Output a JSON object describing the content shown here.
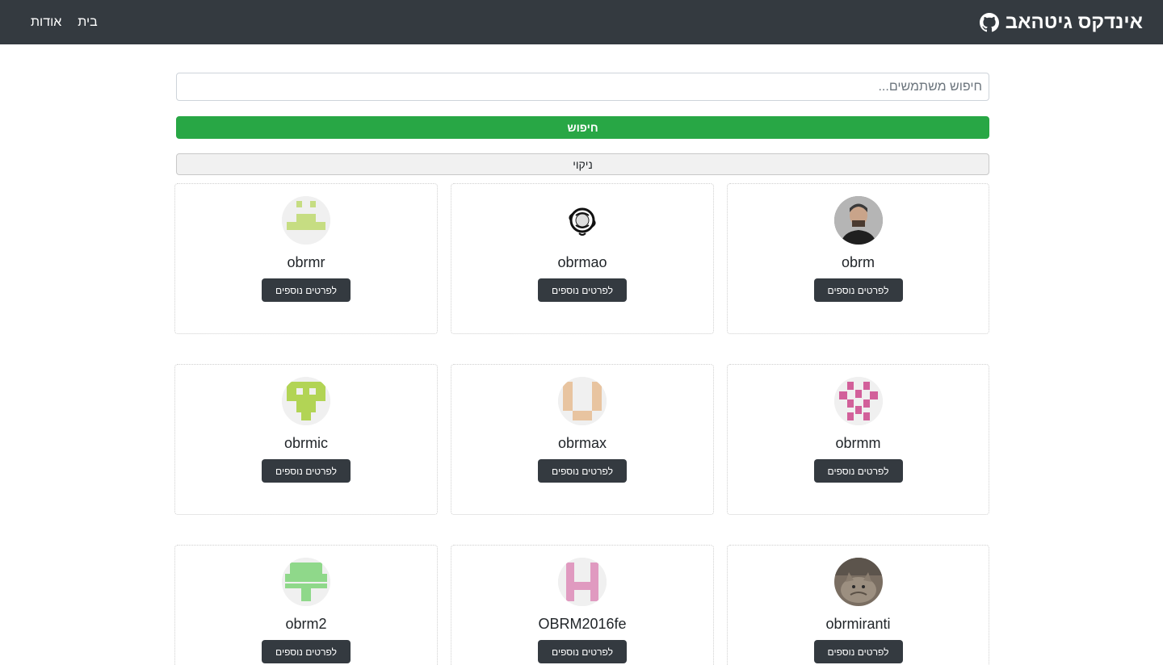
{
  "navbar": {
    "brand": "אינדקס גיטהאב",
    "brand_icon": "github-icon",
    "links": [
      "בית",
      "אודות"
    ]
  },
  "search": {
    "placeholder": "חיפוש משתמשים...",
    "value": "",
    "submit_label": "חיפוש",
    "clear_label": "ניקוי"
  },
  "colors": {
    "navbar": "#343a40",
    "search_button": "#28a745",
    "more_button": "#343a40"
  },
  "users": [
    {
      "login": "obrm",
      "avatar": "photo-portrait-icon",
      "button": "לפרטים נוספים"
    },
    {
      "login": "obrmao",
      "avatar": "ornament-icon",
      "button": "לפרטים נוספים"
    },
    {
      "login": "obrmr",
      "avatar": "identicon-green-icon",
      "button": "לפרטים נוספים"
    },
    {
      "login": "obrmm",
      "avatar": "identicon-pink-icon",
      "button": "לפרטים נוספים"
    },
    {
      "login": "obrmax",
      "avatar": "identicon-peach-icon",
      "button": "לפרטים נוספים"
    },
    {
      "login": "obrmic",
      "avatar": "identicon-lime-icon",
      "button": "לפרטים נוספים"
    },
    {
      "login": "obrmiranti",
      "avatar": "photo-cat-icon",
      "button": "לפרטים נוספים"
    },
    {
      "login": "OBRM2016fe",
      "avatar": "identicon-rose-icon",
      "button": "לפרטים נוספים"
    },
    {
      "login": "obrm2",
      "avatar": "identicon-mint-icon",
      "button": "לפרטים נוספים"
    }
  ]
}
